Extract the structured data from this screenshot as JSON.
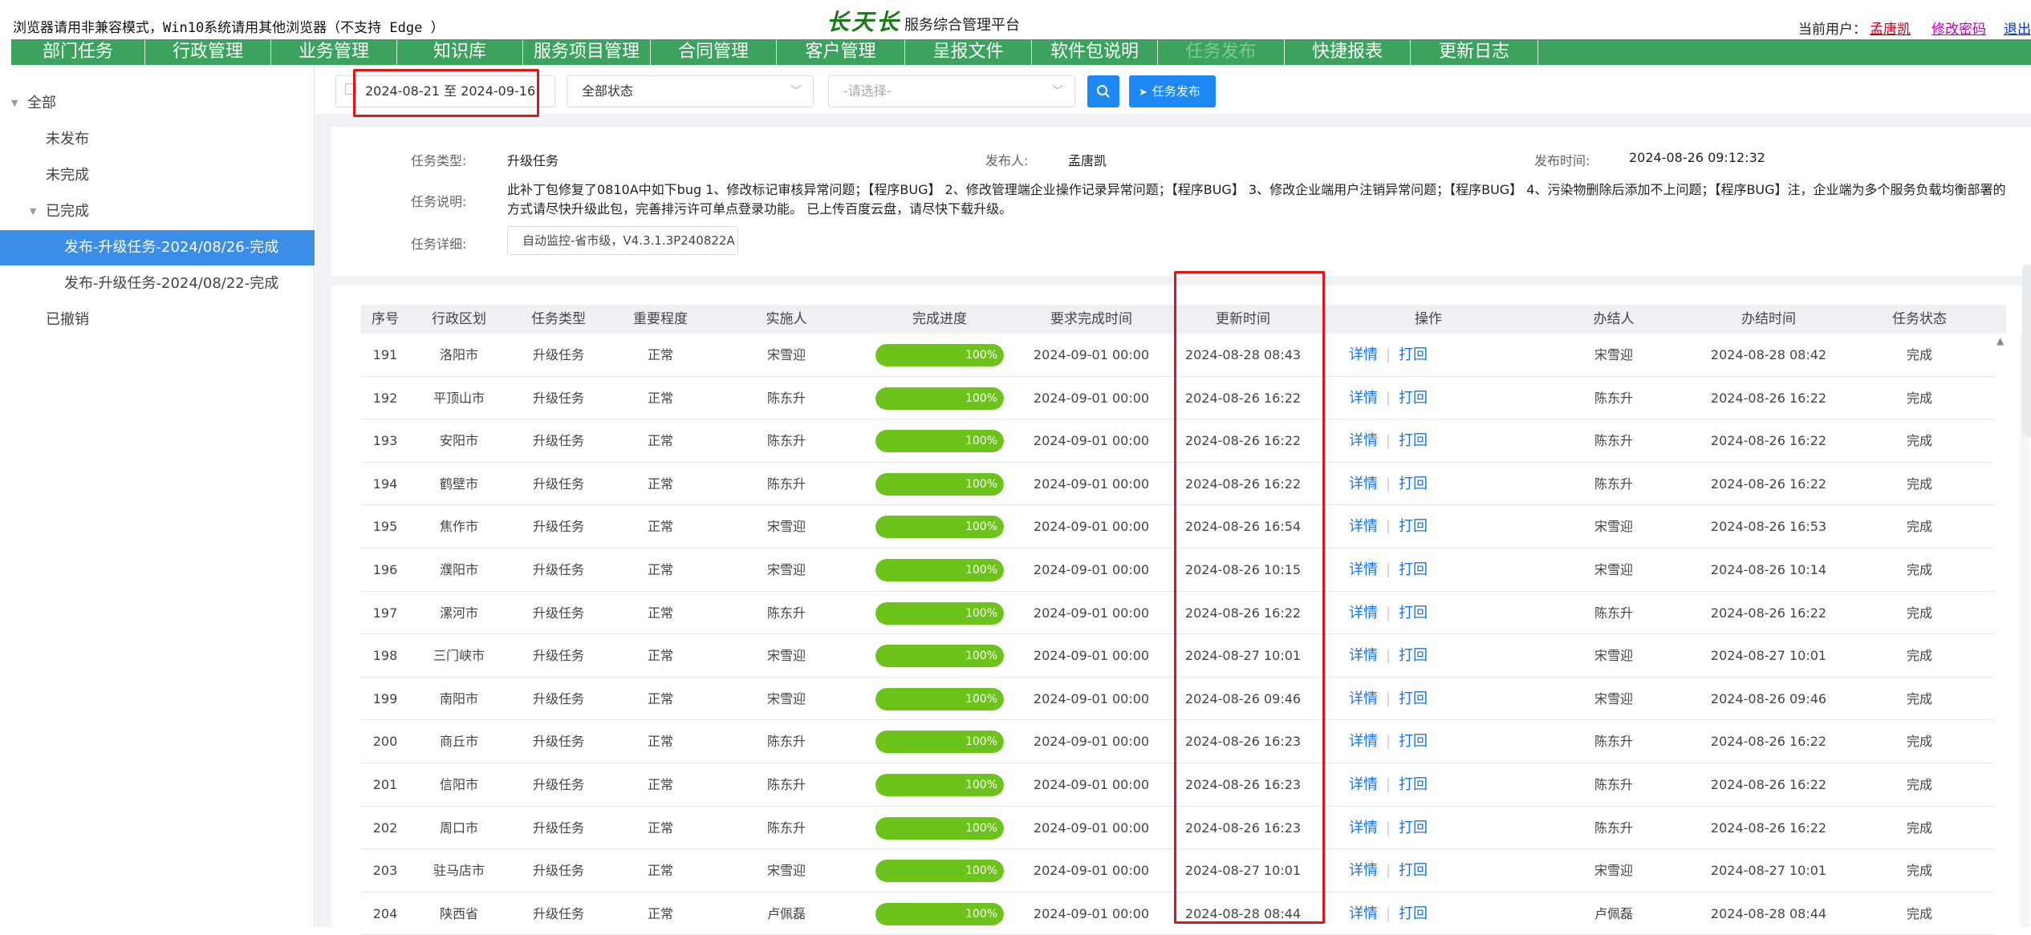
{
  "header": {
    "notice": "浏览器请用非兼容模式，Win10系统请用其他浏览器（不支持 Edge ）",
    "brand_logo": "长天长",
    "brand_subtitle": "服务综合管理平台",
    "current_user_label": "当前用户：",
    "current_user": "孟唐凯",
    "change_password": "修改密码",
    "logout": "退出"
  },
  "nav": {
    "items": [
      {
        "label": "部门任务",
        "active": false
      },
      {
        "label": "行政管理",
        "active": false
      },
      {
        "label": "业务管理",
        "active": false
      },
      {
        "label": "知识库",
        "active": false
      },
      {
        "label": "服务项目管理",
        "active": false
      },
      {
        "label": "合同管理",
        "active": false
      },
      {
        "label": "客户管理",
        "active": false
      },
      {
        "label": "呈报文件",
        "active": false
      },
      {
        "label": "软件包说明",
        "active": false
      },
      {
        "label": "任务发布",
        "active": true
      },
      {
        "label": "快捷报表",
        "active": false
      },
      {
        "label": "更新日志",
        "active": false
      }
    ]
  },
  "sidebar": {
    "items": [
      {
        "label": "全部",
        "level": 0,
        "expanded": true,
        "selected": false
      },
      {
        "label": "未发布",
        "level": 1,
        "selected": false
      },
      {
        "label": "未完成",
        "level": 1,
        "selected": false
      },
      {
        "label": "已完成",
        "level": 1,
        "expanded": true,
        "selected": false
      },
      {
        "label": "发布-升级任务-2024/08/26-完成",
        "level": 2,
        "selected": true
      },
      {
        "label": "发布-升级任务-2024/08/22-完成",
        "level": 2,
        "selected": false
      },
      {
        "label": "已撤销",
        "level": 1,
        "selected": false
      }
    ]
  },
  "toolbar": {
    "date_range": "2024-08-21  至 2024-09-16",
    "status_select": "全部状态",
    "second_select_placeholder": "-请选择-",
    "publish_button": "任务发布"
  },
  "detail": {
    "type_label": "任务类型:",
    "type_value": "升级任务",
    "publisher_label": "发布人:",
    "publisher_value": "孟唐凯",
    "time_label": "发布时间:",
    "time_value": "2024-08-26 09:12:32",
    "desc_label": "任务说明:",
    "desc_value": "此补丁包修复了0810A中如下bug 1、修改标记审核异常问题；【程序BUG】 2、修改管理端企业操作记录异常问题；【程序BUG】 3、修改企业端用户注销异常问题；【程序BUG】 4、污染物删除后添加不上问题；【程序BUG】注，企业端为多个服务负载均衡部署的方式请尽快升级此包，完善排污许可单点登录功能。 已上传百度云盘，请尽快下载升级。",
    "detail_label": "任务详细:",
    "detail_value": "自动监控-省市级，V4.3.1.3P240822A"
  },
  "table": {
    "columns": [
      "序号",
      "行政区划",
      "任务类型",
      "重要程度",
      "实施人",
      "完成进度",
      "要求完成时间",
      "更新时间",
      "操作",
      "办结人",
      "办结时间",
      "任务状态"
    ],
    "op_detail": "详情",
    "op_return": "打回",
    "rows": [
      {
        "no": "191",
        "region": "洛阳市",
        "type": "升级任务",
        "priority": "正常",
        "assignee": "宋雪迎",
        "progress": 100,
        "progress_text": "100%",
        "due": "2024-09-01 00:00",
        "updated": "2024-08-28 08:43",
        "closer": "宋雪迎",
        "closed": "2024-08-28 08:42",
        "status": "完成"
      },
      {
        "no": "192",
        "region": "平顶山市",
        "type": "升级任务",
        "priority": "正常",
        "assignee": "陈东升",
        "progress": 100,
        "progress_text": "100%",
        "due": "2024-09-01 00:00",
        "updated": "2024-08-26 16:22",
        "closer": "陈东升",
        "closed": "2024-08-26 16:22",
        "status": "完成"
      },
      {
        "no": "193",
        "region": "安阳市",
        "type": "升级任务",
        "priority": "正常",
        "assignee": "陈东升",
        "progress": 100,
        "progress_text": "100%",
        "due": "2024-09-01 00:00",
        "updated": "2024-08-26 16:22",
        "closer": "陈东升",
        "closed": "2024-08-26 16:22",
        "status": "完成"
      },
      {
        "no": "194",
        "region": "鹤壁市",
        "type": "升级任务",
        "priority": "正常",
        "assignee": "陈东升",
        "progress": 100,
        "progress_text": "100%",
        "due": "2024-09-01 00:00",
        "updated": "2024-08-26 16:22",
        "closer": "陈东升",
        "closed": "2024-08-26 16:22",
        "status": "完成"
      },
      {
        "no": "195",
        "region": "焦作市",
        "type": "升级任务",
        "priority": "正常",
        "assignee": "宋雪迎",
        "progress": 100,
        "progress_text": "100%",
        "due": "2024-09-01 00:00",
        "updated": "2024-08-26 16:54",
        "closer": "宋雪迎",
        "closed": "2024-08-26 16:53",
        "status": "完成"
      },
      {
        "no": "196",
        "region": "濮阳市",
        "type": "升级任务",
        "priority": "正常",
        "assignee": "宋雪迎",
        "progress": 100,
        "progress_text": "100%",
        "due": "2024-09-01 00:00",
        "updated": "2024-08-26 10:15",
        "closer": "宋雪迎",
        "closed": "2024-08-26 10:14",
        "status": "完成"
      },
      {
        "no": "197",
        "region": "漯河市",
        "type": "升级任务",
        "priority": "正常",
        "assignee": "陈东升",
        "progress": 100,
        "progress_text": "100%",
        "due": "2024-09-01 00:00",
        "updated": "2024-08-26 16:22",
        "closer": "陈东升",
        "closed": "2024-08-26 16:22",
        "status": "完成"
      },
      {
        "no": "198",
        "region": "三门峡市",
        "type": "升级任务",
        "priority": "正常",
        "assignee": "宋雪迎",
        "progress": 100,
        "progress_text": "100%",
        "due": "2024-09-01 00:00",
        "updated": "2024-08-27 10:01",
        "closer": "宋雪迎",
        "closed": "2024-08-27 10:01",
        "status": "完成"
      },
      {
        "no": "199",
        "region": "南阳市",
        "type": "升级任务",
        "priority": "正常",
        "assignee": "宋雪迎",
        "progress": 100,
        "progress_text": "100%",
        "due": "2024-09-01 00:00",
        "updated": "2024-08-26 09:46",
        "closer": "宋雪迎",
        "closed": "2024-08-26 09:46",
        "status": "完成"
      },
      {
        "no": "200",
        "region": "商丘市",
        "type": "升级任务",
        "priority": "正常",
        "assignee": "陈东升",
        "progress": 100,
        "progress_text": "100%",
        "due": "2024-09-01 00:00",
        "updated": "2024-08-26 16:23",
        "closer": "陈东升",
        "closed": "2024-08-26 16:22",
        "status": "完成"
      },
      {
        "no": "201",
        "region": "信阳市",
        "type": "升级任务",
        "priority": "正常",
        "assignee": "陈东升",
        "progress": 100,
        "progress_text": "100%",
        "due": "2024-09-01 00:00",
        "updated": "2024-08-26 16:23",
        "closer": "陈东升",
        "closed": "2024-08-26 16:22",
        "status": "完成"
      },
      {
        "no": "202",
        "region": "周口市",
        "type": "升级任务",
        "priority": "正常",
        "assignee": "陈东升",
        "progress": 100,
        "progress_text": "100%",
        "due": "2024-09-01 00:00",
        "updated": "2024-08-26 16:23",
        "closer": "陈东升",
        "closed": "2024-08-26 16:22",
        "status": "完成"
      },
      {
        "no": "203",
        "region": "驻马店市",
        "type": "升级任务",
        "priority": "正常",
        "assignee": "宋雪迎",
        "progress": 100,
        "progress_text": "100%",
        "due": "2024-09-01 00:00",
        "updated": "2024-08-27 10:01",
        "closer": "宋雪迎",
        "closed": "2024-08-27 10:01",
        "status": "完成"
      },
      {
        "no": "204",
        "region": "陕西省",
        "type": "升级任务",
        "priority": "正常",
        "assignee": "卢佩磊",
        "progress": 100,
        "progress_text": "100%",
        "due": "2024-09-01 00:00",
        "updated": "2024-08-28 08:44",
        "closer": "卢佩磊",
        "closed": "2024-08-28 08:44",
        "status": "完成"
      }
    ]
  },
  "colors": {
    "nav_bg": "#3ca35f",
    "primary_blue": "#1e88f5",
    "progress_green": "#6cc31b",
    "highlight_red": "#e0141b"
  }
}
